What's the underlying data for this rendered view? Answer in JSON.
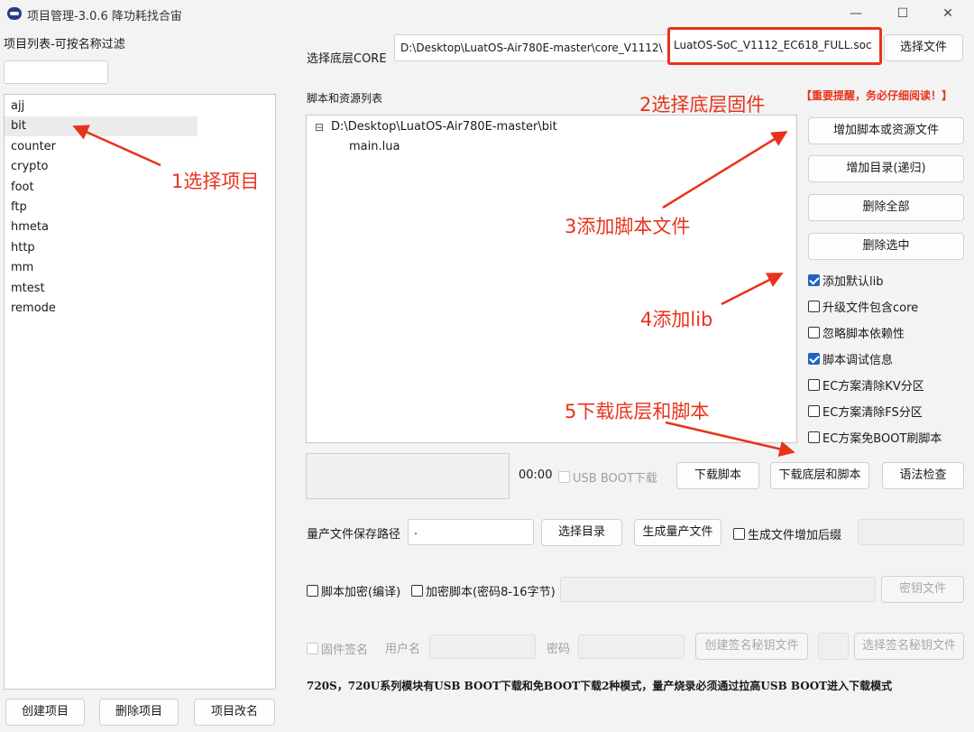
{
  "window": {
    "title": "项目管理-3.0.6 降功耗找合宙",
    "minimize": "—",
    "maximize": "☐",
    "close": "✕"
  },
  "sidebar": {
    "filter_label": "项目列表-可按名称过滤",
    "filter_value": "",
    "projects": [
      "ajj",
      "bit",
      "counter",
      "crypto",
      "foot",
      "ftp",
      "hmeta",
      "http",
      "mm",
      "mtest",
      "remode"
    ],
    "selected": "bit",
    "create_button": "创建项目",
    "delete_button": "删除项目",
    "rename_button": "项目改名"
  },
  "core": {
    "label": "选择底层CORE",
    "path_prefix": "D:\\Desktop\\LuatOS-Air780E-master\\core_V1112\\",
    "path_highlight": "LuatOS-SoC_V1112_EC618_FULL.soc",
    "select_file_button": "选择文件"
  },
  "scripts": {
    "label": "脚本和资源列表",
    "warning": "【重要提醒，务必仔细阅读！】",
    "tree_toggle": "⊟",
    "tree_root": "D:\\Desktop\\LuatOS-Air780E-master\\bit",
    "tree_files": [
      "main.lua"
    ],
    "add_script_button": "增加脚本或资源文件",
    "add_dir_button": "增加目录(递归)",
    "delete_all_button": "删除全部",
    "delete_selected_button": "删除选中"
  },
  "options": [
    {
      "label": "添加默认lib",
      "checked": true
    },
    {
      "label": "升级文件包含core",
      "checked": false
    },
    {
      "label": "忽略脚本依赖性",
      "checked": false
    },
    {
      "label": "脚本调试信息",
      "checked": true
    },
    {
      "label": "EC方案清除KV分区",
      "checked": false
    },
    {
      "label": "EC方案清除FS分区",
      "checked": false
    },
    {
      "label": "EC方案免BOOT刷脚本",
      "checked": false
    }
  ],
  "download": {
    "timer": "00:00",
    "usb_boot_label": "USB BOOT下载",
    "download_script_button": "下载脚本",
    "download_all_button": "下载底层和脚本",
    "syntax_check_button": "语法检查"
  },
  "mass_production": {
    "path_label": "量产文件保存路径",
    "path_value": ".",
    "select_dir_button": "选择目录",
    "generate_button": "生成量产文件",
    "suffix_label": "生成文件增加后缀",
    "suffix_value": ""
  },
  "encryption": {
    "encrypt_compile_label": "脚本加密(编译)",
    "encrypt_script_label": "加密脚本(密码8-16字节)",
    "password_value": "",
    "key_file_button": "密钥文件"
  },
  "signature": {
    "firmware_sign_label": "固件签名",
    "username_label": "用户名",
    "password_label": "密码",
    "create_key_button": "创建签名秘钥文件",
    "select_key_button": "选择签名秘钥文件"
  },
  "footer_note": "720S，720U系列模块有USB BOOT下载和免BOOT下载2种模式，量产烧录必须通过拉高USB BOOT进入下载模式",
  "annotations": {
    "step1": "1选择项目",
    "step2": "2选择底层固件",
    "step3": "3添加脚本文件",
    "step4": "4添加lib",
    "step5": "5下载底层和脚本",
    "color": "#e8331c"
  }
}
